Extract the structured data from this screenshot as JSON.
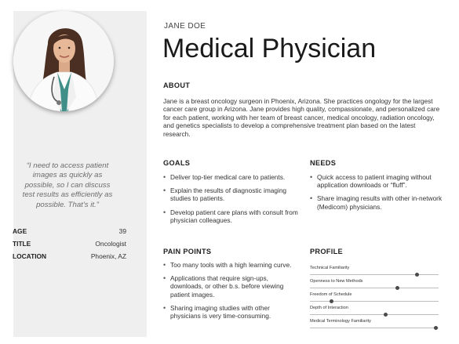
{
  "persona": {
    "name": "JANE DOE",
    "title": "Medical Physician",
    "quote": "“I need to access patient images as quickly as possible, so I can discuss test results as efficiently as possible. That’s it.”",
    "facts": [
      {
        "label": "AGE",
        "value": "39"
      },
      {
        "label": "TITLE",
        "value": "Oncologist"
      },
      {
        "label": "LOCATION",
        "value": "Phoenix, AZ"
      }
    ]
  },
  "about": {
    "heading": "ABOUT",
    "text": "Jane is a breast oncology surgeon in Phoenix, Arizona. She practices ongology for the largest cancer care group in Arizona. Jane provides high quality, compassionate, and personalized care for each patient, working with her team of breast cancer, medical oncology, radiation oncology, and genetics specialists to develop a comprehensive treatment plan based on the latest research."
  },
  "goals": {
    "heading": "GOALS",
    "items": [
      "Deliver top-tier medical care to patients.",
      "Explain the results of diagnostic imaging studies to patients.",
      "Develop patient care plans with consult from physician colleagues."
    ]
  },
  "needs": {
    "heading": "NEEDS",
    "items": [
      "Quick access to patient imaging without application downloads or “fluff”.",
      "Share imaging results with other in-network (Medicom) physicians."
    ]
  },
  "pain_points": {
    "heading": "PAIN POINTS",
    "items": [
      "Too many tools with a high learning curve.",
      "Applications that require sign-ups, downloads, or other b.s. before viewing patient images.",
      "Sharing imaging studies with other physicians is very time-consuming."
    ]
  },
  "profile": {
    "heading": "PROFILE",
    "traits": [
      {
        "label": "Technical Familiarity",
        "level": 0.83
      },
      {
        "label": "Openness to New Methods",
        "level": 0.68
      },
      {
        "label": "Freedom of Schedule",
        "level": 0.17
      },
      {
        "label": "Depth of Interaction",
        "level": 0.59
      },
      {
        "label": "Medical Terminology Familiarity",
        "level": 0.98
      }
    ]
  },
  "colors": {
    "sidebar_bg": "#efefef",
    "scrubs": "#3f8f88",
    "coat": "#ffffff",
    "hair": "#4a2f22"
  },
  "icons": [
    "profile-photo"
  ]
}
